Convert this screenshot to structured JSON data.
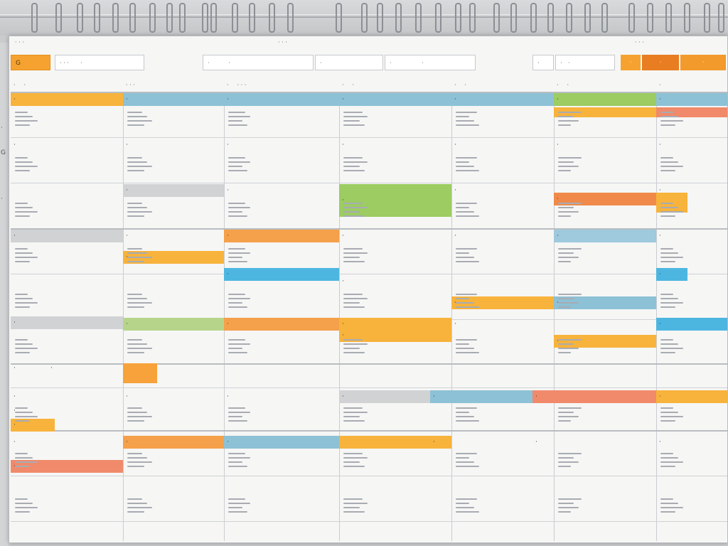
{
  "header": {
    "left_text": "· · ·",
    "center_text": "· · ·",
    "right_text": "· · ·"
  },
  "toolbar": {
    "menu_label": "G",
    "fields": [
      {
        "label": "· · ·",
        "value": "·"
      },
      {
        "label": "·",
        "value": "·"
      },
      {
        "label": "·",
        "value": "·"
      },
      {
        "label": "·",
        "value": "·"
      },
      {
        "label": "·",
        "value": "·"
      },
      {
        "label": "·",
        "value": "·"
      }
    ],
    "buttons": [
      "·",
      "·",
      "·"
    ]
  },
  "columns": [
    {
      "label": "·",
      "sub": "·"
    },
    {
      "label": "· · ·",
      "sub": ""
    },
    {
      "label": "·",
      "sub": "· · ·"
    },
    {
      "label": "·",
      "sub": "·"
    },
    {
      "label": "·",
      "sub": "·"
    },
    {
      "label": "·",
      "sub": "·"
    },
    {
      "label": "·",
      "sub": ""
    }
  ],
  "events": [
    {
      "label": "·",
      "color": "#f7b33c"
    },
    {
      "label": "·",
      "color": "#8dc1d6"
    },
    {
      "label": "·",
      "color": "#8dc1d6"
    },
    {
      "label": "·",
      "color": "#8dc1d6"
    },
    {
      "label": "·",
      "color": "#8dc1d6"
    },
    {
      "label": "·",
      "color": "#9ccc62"
    },
    {
      "label": "·",
      "color": "#8dc1d6"
    },
    {
      "label": "",
      "color": "#f7b33c"
    },
    {
      "label": "",
      "color": "#f08a6a"
    },
    {
      "label": "·",
      "color": ""
    },
    {
      "label": "·",
      "color": ""
    },
    {
      "label": "·",
      "color": ""
    },
    {
      "label": "·",
      "color": ""
    },
    {
      "label": "·",
      "color": ""
    },
    {
      "label": "·",
      "color": ""
    },
    {
      "label": "·",
      "color": ""
    },
    {
      "label": "·",
      "color": "#d0d2d4"
    },
    {
      "label": "·",
      "color": ""
    },
    {
      "label": "·",
      "color": "#9ccc62"
    },
    {
      "label": "·",
      "color": ""
    },
    {
      "label": "·",
      "color": "#f08a4a"
    },
    {
      "label": "·",
      "color": ""
    },
    {
      "label": "",
      "color": "#f7b33c"
    },
    {
      "label": "·",
      "color": "#d0d2d4"
    },
    {
      "label": "·",
      "color": ""
    },
    {
      "label": "·",
      "color": "#f5a04a"
    },
    {
      "label": "·",
      "color": ""
    },
    {
      "label": "·",
      "color": ""
    },
    {
      "label": "·",
      "color": "#9fc9dc"
    },
    {
      "label": "·",
      "color": ""
    },
    {
      "label": "·",
      "color": "#f7b33c"
    },
    {
      "label": "·",
      "color": "#4db6e0"
    },
    {
      "label": "·",
      "color": ""
    },
    {
      "label": "·",
      "color": "#4db6e0"
    },
    {
      "label": "·",
      "color": "#f7b33c"
    },
    {
      "label": "·",
      "color": "#8dc1d6"
    },
    {
      "label": "·",
      "color": "#d0d2d4"
    },
    {
      "label": "·",
      "color": "#b6d58a"
    },
    {
      "label": "·",
      "color": "#f5a04a"
    },
    {
      "label": "·",
      "color": "#f7b33c"
    },
    {
      "label": "·",
      "color": "#f7b33c"
    },
    {
      "label": "·",
      "color": ""
    },
    {
      "label": "·",
      "color": "#f7b33c"
    },
    {
      "label": "·",
      "color": "#4db6e0"
    },
    {
      "label": "·",
      "color": ""
    },
    {
      "label": "",
      "color": "#f7a23a"
    },
    {
      "label": "·",
      "color": ""
    },
    {
      "label": "·",
      "color": ""
    },
    {
      "label": "·",
      "color": ""
    },
    {
      "label": "·",
      "color": ""
    },
    {
      "label": "·",
      "color": "#d0d2d4"
    },
    {
      "label": "·",
      "color": "#8dc1d6"
    },
    {
      "label": "·",
      "color": "#f08a6a"
    },
    {
      "label": "·",
      "color": "#f7b33c"
    },
    {
      "label": "·",
      "color": ""
    },
    {
      "label": "·",
      "color": "#f7b33c"
    },
    {
      "label": "·",
      "color": ""
    },
    {
      "label": "·",
      "color": "#f5a04a"
    },
    {
      "label": "·",
      "color": "#8dc1d6"
    },
    {
      "label": "",
      "color": "#f7b33c"
    },
    {
      "label": "·",
      "color": ""
    },
    {
      "label": "·",
      "color": ""
    },
    {
      "label": "·",
      "color": ""
    },
    {
      "label": "·",
      "color": "#f08a6a"
    }
  ],
  "gutter_marks": [
    "·",
    "G",
    "·"
  ],
  "accent_colors": {
    "orange": "#f6a230",
    "yellow": "#f7b33c",
    "blue": "#8dc1d6",
    "cyan": "#4db6e0",
    "green": "#9ccc62",
    "salmon": "#f08a6a",
    "grey": "#d0d2d4"
  }
}
